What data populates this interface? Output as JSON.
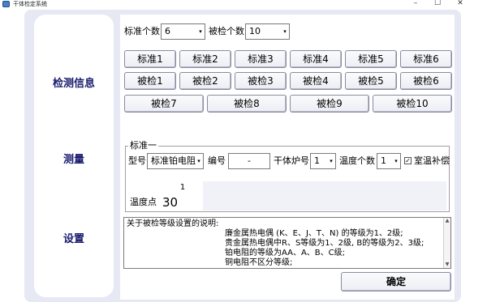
{
  "window": {
    "title": "干体检定系统",
    "controls": {
      "minimize": "–",
      "maximize": "☐",
      "close": "✕"
    }
  },
  "sidebar": {
    "items": [
      {
        "label": "检测信息"
      },
      {
        "label": "测量"
      },
      {
        "label": "设置"
      }
    ]
  },
  "top": {
    "std_count_label": "标准个数",
    "std_count_value": "6",
    "dut_count_label": "被检个数",
    "dut_count_value": "10"
  },
  "standards": [
    "标准1",
    "标准2",
    "标准3",
    "标准4",
    "标准5",
    "标准6"
  ],
  "duts_row1": [
    "被检1",
    "被检2",
    "被检3",
    "被检4",
    "被检5",
    "被检6"
  ],
  "duts_row2": [
    "被检7",
    "被检8",
    "被检9",
    "被检10"
  ],
  "group": {
    "title": "标准一",
    "model_label": "型号",
    "model_value": "标准铂电阻",
    "serial_label": "编号",
    "serial_value": "-",
    "furnace_label": "干体炉号",
    "furnace_value": "1",
    "temp_count_label": "温度个数",
    "temp_count_value": "1",
    "room_comp_label": "室温补偿",
    "room_comp_checked": true,
    "check_mark": "✓",
    "temp_point_label": "温度点",
    "grid": {
      "header": "1",
      "value": "30"
    }
  },
  "description": {
    "lines": [
      "关于被检等级设置的说明:",
      "廉金属热电偶 (K、E、J、T、N) 的等级为1、2级;",
      "贵金属热电偶中R、S等级为1、2级, B的等级为2、3级;",
      "铂电阻的等级为AA、A、B、C级;",
      "铜电阻不区分等级;"
    ]
  },
  "confirm_label": "确定",
  "icons": {
    "dropdown": "▾",
    "scroll_up": "▲",
    "scroll_down": "▼"
  },
  "colors": {
    "window_bg": "#e6e8f4",
    "sidebar_text": "#1a1a6e"
  }
}
